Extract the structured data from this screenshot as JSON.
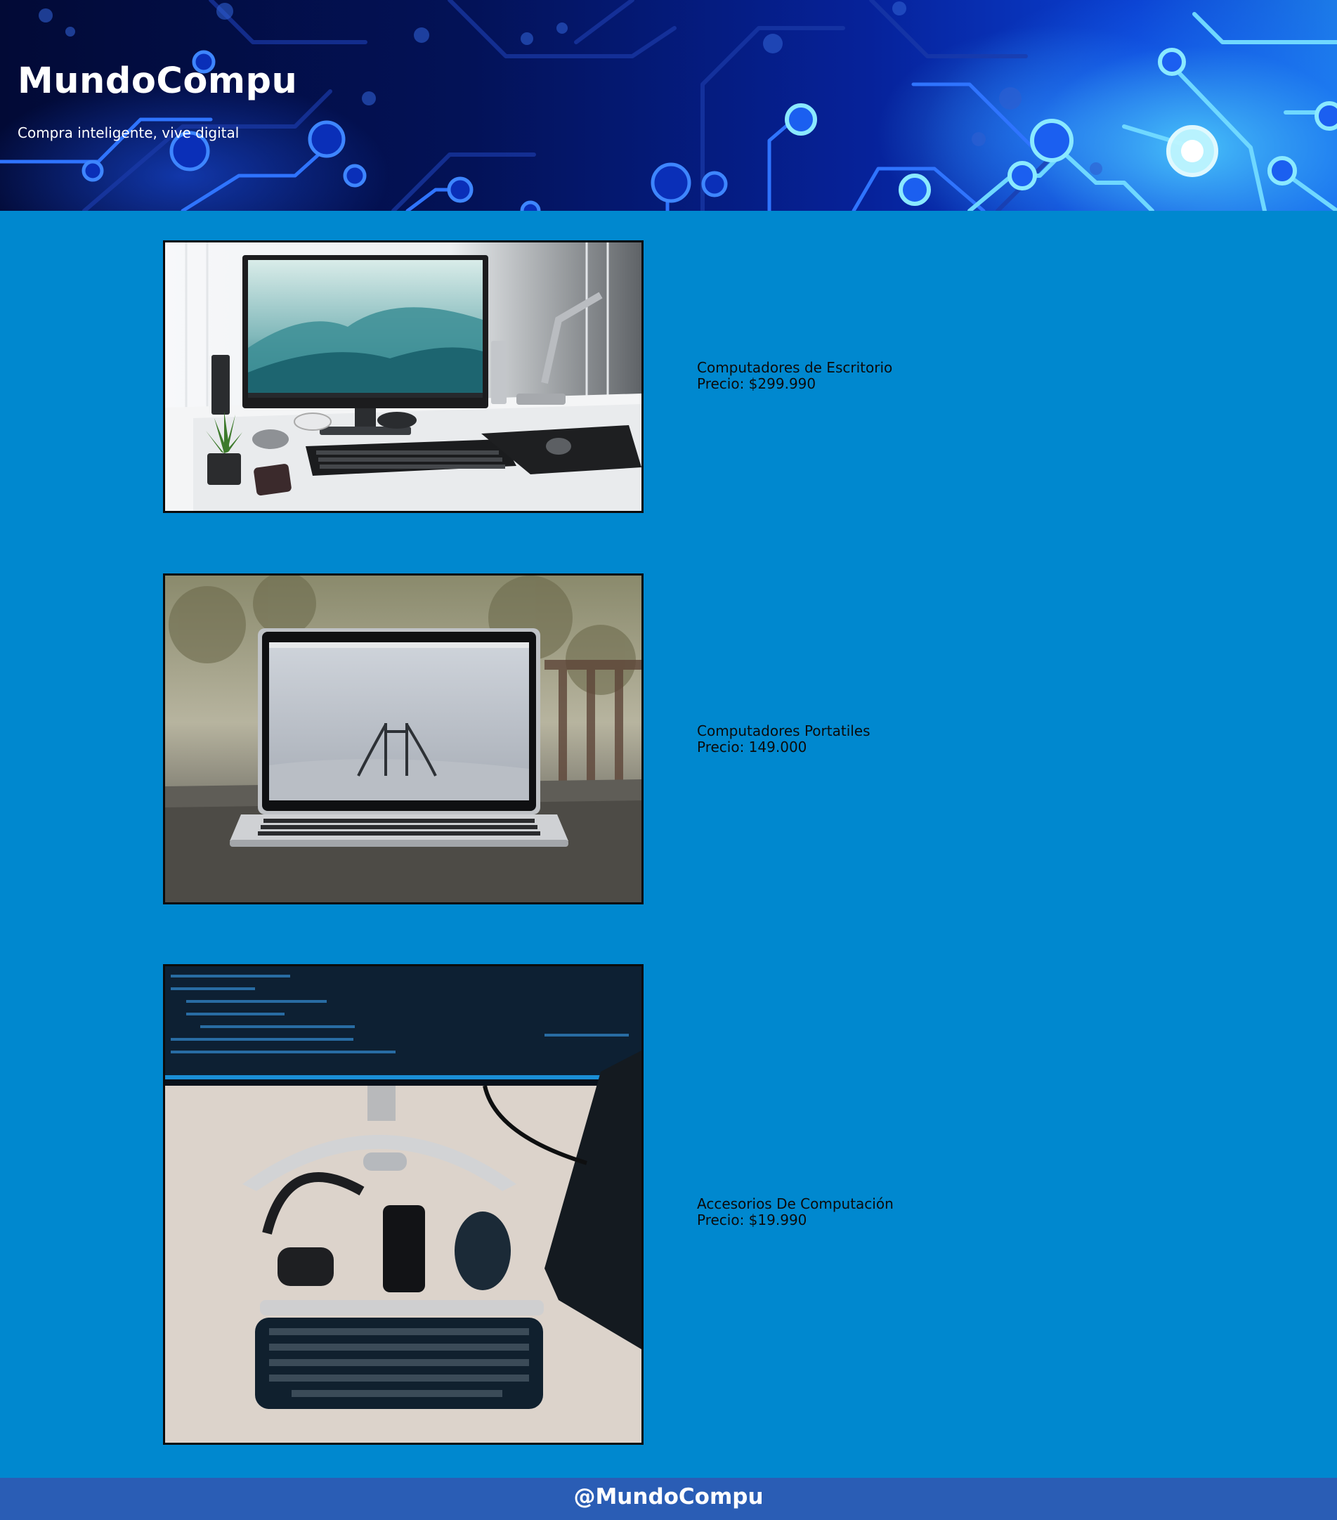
{
  "header": {
    "title": "MundoCompu",
    "tagline": "Compra inteligente, vive digital"
  },
  "products": [
    {
      "name": "Computadores de Escritorio",
      "price": "Precio: $299.990",
      "image": "desktop-computer-photo"
    },
    {
      "name": "Computadores Portatiles",
      "price": "Precio: 149.000",
      "image": "laptop-photo"
    },
    {
      "name": "Accesorios De Computación",
      "price": "Precio: $19.990",
      "image": "computer-accessories-photo"
    }
  ],
  "footer": {
    "handle": "@MundoCompu"
  },
  "colors": {
    "page_background": "#0088cf",
    "footer_background": "#2a5db5",
    "header_dark": "#020a36",
    "header_glow": "#50d2ff",
    "text_dark": "#0b0b0b",
    "text_light": "#ffffff"
  }
}
